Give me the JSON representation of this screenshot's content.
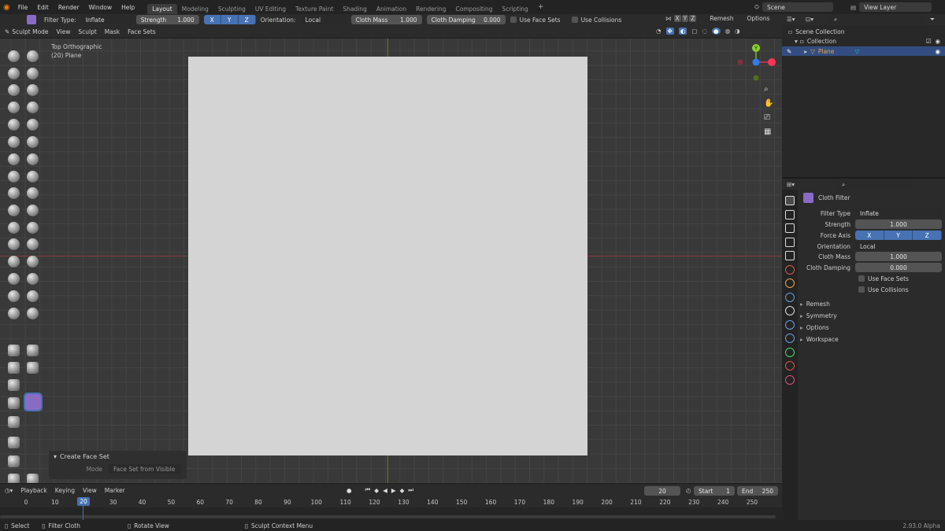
{
  "menus": [
    "File",
    "Edit",
    "Render",
    "Window",
    "Help"
  ],
  "workspaces": [
    {
      "label": "Layout",
      "active": true
    },
    {
      "label": "Modeling"
    },
    {
      "label": "Sculpting"
    },
    {
      "label": "UV Editing"
    },
    {
      "label": "Texture Paint"
    },
    {
      "label": "Shading"
    },
    {
      "label": "Animation"
    },
    {
      "label": "Rendering"
    },
    {
      "label": "Compositing"
    },
    {
      "label": "Scripting"
    }
  ],
  "add_tab": "+",
  "scene": "Scene",
  "view_layer": "View Layer",
  "filter": {
    "type_label": "Filter Type:",
    "type": "Inflate",
    "strength_label": "Strength",
    "strength": "1.000",
    "axes": [
      "X",
      "Y",
      "Z"
    ],
    "orientation_label": "Orientation:",
    "orientation": "Local",
    "cloth_mass_label": "Cloth Mass",
    "cloth_mass": "1.000",
    "cloth_damping_label": "Cloth Damping",
    "cloth_damping": "0.000",
    "use_face_sets": "Use Face Sets",
    "use_collisions": "Use Collisions"
  },
  "header_right": {
    "axes": [
      "X",
      "Y",
      "Z"
    ],
    "remesh": "Remesh",
    "options": "Options"
  },
  "mode": {
    "label": "Sculpt Mode",
    "items": [
      "View",
      "Sculpt",
      "Mask",
      "Face Sets"
    ]
  },
  "viewport": {
    "view_name": "Top Orthographic",
    "object": "(20) Plane"
  },
  "gizmo": {
    "y": "Y"
  },
  "operator_panel": {
    "title": "Create Face Set",
    "mode_label": "Mode",
    "mode_value": "Face Set from Visible"
  },
  "outliner": {
    "root": "Scene Collection",
    "collection": "Collection",
    "object": "Plane"
  },
  "properties": {
    "tool_title": "Cloth Filter",
    "filter_type_label": "Filter Type",
    "filter_type": "Inflate",
    "strength_label": "Strength",
    "strength": "1.000",
    "force_axis_label": "Force Axis",
    "axes": [
      "X",
      "Y",
      "Z"
    ],
    "orientation_label": "Orientation",
    "orientation": "Local",
    "cloth_mass_label": "Cloth Mass",
    "cloth_mass": "1.000",
    "cloth_damping_label": "Cloth Damping",
    "cloth_damping": "0.000",
    "use_face_sets": "Use Face Sets",
    "use_collisions": "Use Collisions",
    "panels": [
      "Remesh",
      "Symmetry",
      "Options",
      "Workspace"
    ]
  },
  "timeline": {
    "menus": [
      "Playback",
      "Keying",
      "View",
      "Marker"
    ],
    "current_frame": "20",
    "start_label": "Start",
    "start": "1",
    "end_label": "End",
    "end": "250",
    "ticks": [
      "0",
      "10",
      "20",
      "30",
      "40",
      "50",
      "60",
      "70",
      "80",
      "90",
      "100",
      "110",
      "120",
      "130",
      "140",
      "150",
      "160",
      "170",
      "180",
      "190",
      "200",
      "210",
      "220",
      "230",
      "240",
      "250"
    ]
  },
  "status": {
    "select": "Select",
    "filter": "Filter Cloth",
    "rotate": "Rotate View",
    "context": "Sculpt Context Menu",
    "version": "2.93.0 Alpha"
  }
}
